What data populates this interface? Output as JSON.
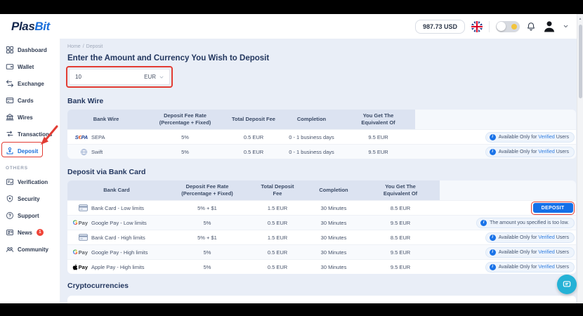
{
  "brand": {
    "name_primary": "Plas",
    "name_secondary": "Bit"
  },
  "header": {
    "balance": "987.73 USD"
  },
  "sidebar": {
    "main_items": [
      {
        "label": "Dashboard",
        "icon": "dashboard-icon"
      },
      {
        "label": "Wallet",
        "icon": "wallet-icon"
      },
      {
        "label": "Exchange",
        "icon": "exchange-icon"
      },
      {
        "label": "Cards",
        "icon": "cards-icon"
      },
      {
        "label": "Wires",
        "icon": "wires-icon"
      },
      {
        "label": "Transactions",
        "icon": "transactions-icon"
      },
      {
        "label": "Deposit",
        "icon": "deposit-icon",
        "active": true,
        "annotated": true
      }
    ],
    "section_label": "OTHERS",
    "other_items": [
      {
        "label": "Verification",
        "icon": "verification-icon"
      },
      {
        "label": "Security",
        "icon": "security-icon"
      },
      {
        "label": "Support",
        "icon": "support-icon"
      },
      {
        "label": "News",
        "icon": "news-icon",
        "badge": "1"
      },
      {
        "label": "Community",
        "icon": "community-icon"
      }
    ]
  },
  "breadcrumb": {
    "items": [
      "Home",
      "Deposit"
    ],
    "separator": "/"
  },
  "amount_form": {
    "title": "Enter the Amount and Currency You Wish to Deposit",
    "amount_value": "10",
    "currency": "EUR"
  },
  "bank_wire_section": {
    "title": "Bank Wire",
    "columns": [
      [
        "Bank Wire"
      ],
      [
        "Deposit Fee Rate",
        "(Percentage + Fixed)"
      ],
      [
        "Total Deposit Fee"
      ],
      [
        "Completion"
      ],
      [
        "You Get The",
        "Equivalent Of"
      ]
    ],
    "rows": [
      {
        "method": "SEPA",
        "icon": "sepa-logo",
        "fee_rate": "5%",
        "total_fee": "0.5 EUR",
        "completion": "0 - 1 business days",
        "equivalent": "9.5 EUR",
        "action": {
          "type": "verified-badge"
        }
      },
      {
        "method": "Swift",
        "icon": "swift-icon",
        "fee_rate": "5%",
        "total_fee": "0.5 EUR",
        "completion": "0 - 1 business days",
        "equivalent": "9.5 EUR",
        "action": {
          "type": "verified-badge"
        }
      }
    ]
  },
  "bank_card_section": {
    "title": "Deposit via Bank Card",
    "columns": [
      [
        "Bank Card"
      ],
      [
        "Deposit Fee Rate",
        "(Percentage + Fixed)"
      ],
      [
        "Total Deposit",
        "Fee"
      ],
      [
        "Completion"
      ],
      [
        "You Get The",
        "Equivalent Of"
      ]
    ],
    "rows": [
      {
        "method": "Bank Card - Low limits",
        "icon": "bank-card-icon",
        "fee_rate": "5% + $1",
        "total_fee": "1.5 EUR",
        "completion": "30 Minutes",
        "equivalent": "8.5 EUR",
        "action": {
          "type": "deposit-button",
          "label": "DEPOSIT",
          "annotated": true
        }
      },
      {
        "method": "Google Pay - Low limits",
        "icon": "google-pay-logo",
        "fee_rate": "5%",
        "total_fee": "0.5 EUR",
        "completion": "30 Minutes",
        "equivalent": "9.5 EUR",
        "action": {
          "type": "info-badge",
          "text": "The amount you specified is too low."
        }
      },
      {
        "method": "Bank Card - High limits",
        "icon": "bank-card-icon",
        "fee_rate": "5% + $1",
        "total_fee": "1.5 EUR",
        "completion": "30 Minutes",
        "equivalent": "8.5 EUR",
        "action": {
          "type": "verified-badge"
        }
      },
      {
        "method": "Google Pay - High limits",
        "icon": "google-pay-logo",
        "fee_rate": "5%",
        "total_fee": "0.5 EUR",
        "completion": "30 Minutes",
        "equivalent": "9.5 EUR",
        "action": {
          "type": "verified-badge"
        }
      },
      {
        "method": "Apple Pay - High limits",
        "icon": "apple-pay-logo",
        "fee_rate": "5%",
        "total_fee": "0.5 EUR",
        "completion": "30 Minutes",
        "equivalent": "9.5 EUR",
        "action": {
          "type": "verified-badge"
        }
      }
    ]
  },
  "verified_badge": {
    "prefix": "Available Only for ",
    "link": "Verified",
    "suffix": " Users"
  },
  "crypto_section": {
    "title": "Cryptocurrencies"
  },
  "colors": {
    "accent_blue": "#1570e8",
    "active_link_blue": "#1a6fdb",
    "annotation_red": "#e23c33",
    "info_badge_blue": "#1a73e8",
    "chat_teal": "#25b2d6",
    "news_badge_red": "#f04438",
    "content_background": "#e9eef7",
    "table_header_background": "#dce3f1"
  }
}
